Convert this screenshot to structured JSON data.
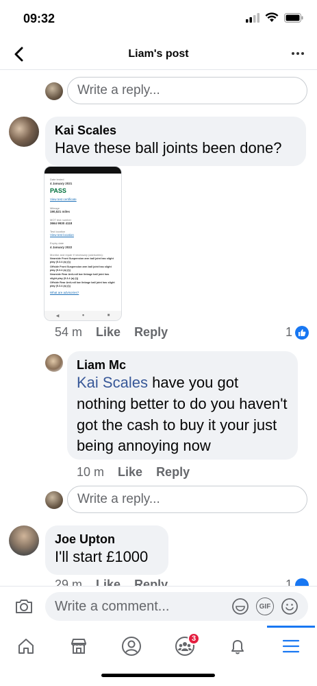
{
  "status": {
    "time": "09:32"
  },
  "header": {
    "title": "Liam's post"
  },
  "reply_placeholder": "Write a reply...",
  "comments": [
    {
      "author": "Kai Scales",
      "text": "Have these ball joints been done?",
      "time": "54 m",
      "like_label": "Like",
      "reply_label": "Reply",
      "like_count": "1"
    },
    {
      "author": "Liam Mc",
      "mention": "Kai Scales",
      "text": "have you got nothing better to do you haven't got the cash to buy it your just being annoying now",
      "time": "10 m",
      "like_label": "Like",
      "reply_label": "Reply"
    },
    {
      "author": "Joe Upton",
      "text": "I'll start £1000",
      "time": "29 m",
      "like_label": "Like",
      "reply_label": "Reply",
      "like_count": "1"
    }
  ],
  "attachment": {
    "date_label": "Date tested",
    "date": "4 January 2021",
    "result": "PASS",
    "cert_link": "View test certificate",
    "mileage_label": "Mileage",
    "mileage": "190,521 miles",
    "mot_label": "MOT test number",
    "mot_number": "3664 9930 4118",
    "location_label": "Test location",
    "location_link": "View test location",
    "expiry_label": "Expiry date",
    "expiry": "4 January 2022",
    "advisory_heading": "Monitor and repair if necessary (advisories):",
    "advisories": [
      "Nearside Front Suspension arm ball joint has slight play (5.3.4 (a) (i))",
      "Offside Front Suspension arm ball joint has slight play (5.3.4 (a) (i))",
      "Nearside Rear Anti-roll bar linkage ball joint has slight play (5.3.4 (a) (i))",
      "Offside Rear Anti-roll bar linkage ball joint has slight play (5.3.4 (a) (i))"
    ],
    "advisories_link": "What are advisories?"
  },
  "composer": {
    "placeholder": "Write a comment...",
    "gif": "GIF"
  },
  "tabbar": {
    "groups_badge": "3"
  },
  "colors": {
    "accent": "#1877f2",
    "mention": "#385898",
    "badge": "#e41e3f",
    "pass": "#00703c"
  }
}
